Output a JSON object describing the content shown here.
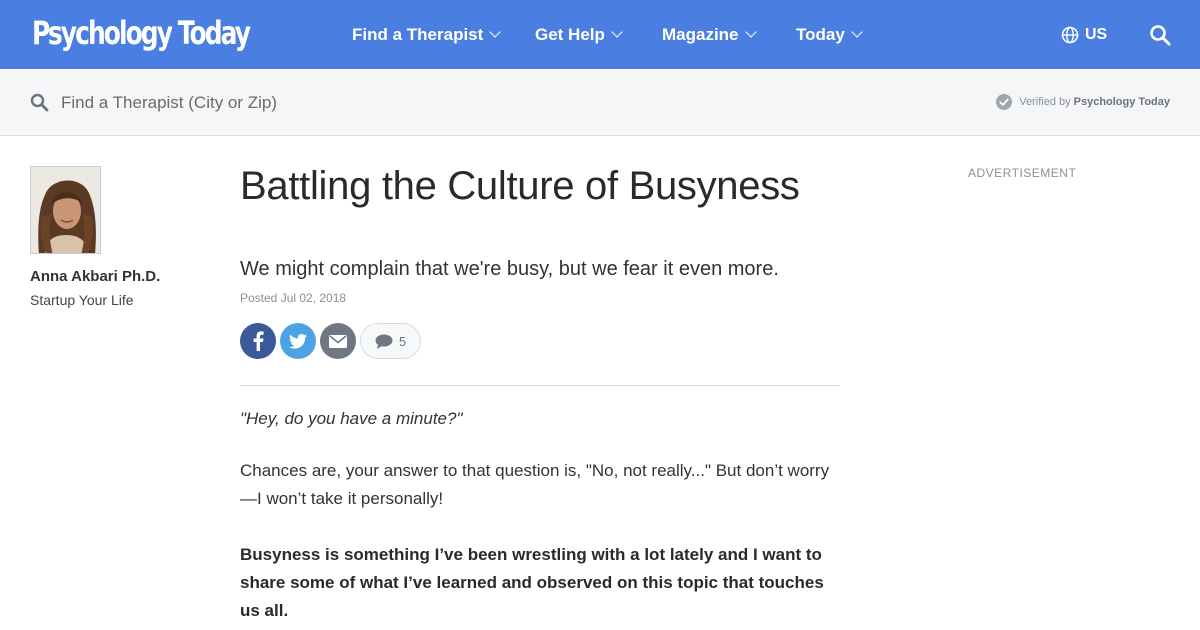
{
  "header": {
    "logo": "Psychology Today",
    "nav": [
      {
        "label": "Find a Therapist"
      },
      {
        "label": "Get Help"
      },
      {
        "label": "Magazine"
      },
      {
        "label": "Today"
      }
    ],
    "region": "US",
    "colors": {
      "brand": "#4a7ee0"
    }
  },
  "search": {
    "placeholder": "Find a Therapist (City or Zip)",
    "verified_prefix": "Verified by",
    "verified_brand": "Psychology Today"
  },
  "author": {
    "name": "Anna Akbari Ph.D.",
    "blog": "Startup Your Life"
  },
  "article": {
    "title": "Battling the Culture of Busyness",
    "subtitle": "We might complain that we're busy, but we fear it even more.",
    "posted": "Posted Jul 02, 2018",
    "comment_count": "5",
    "paragraphs": [
      "\"Hey, do you have a minute?\"",
      "Chances are, your answer to that question is, \"No, not really...\" But don’t worry—I won’t take it personally!",
      "Busyness is something I’ve been wrestling with a lot lately and I want to share some of what I’ve learned and observed on this topic that touches us all."
    ]
  },
  "sidebar": {
    "ad_label": "ADVERTISEMENT"
  }
}
